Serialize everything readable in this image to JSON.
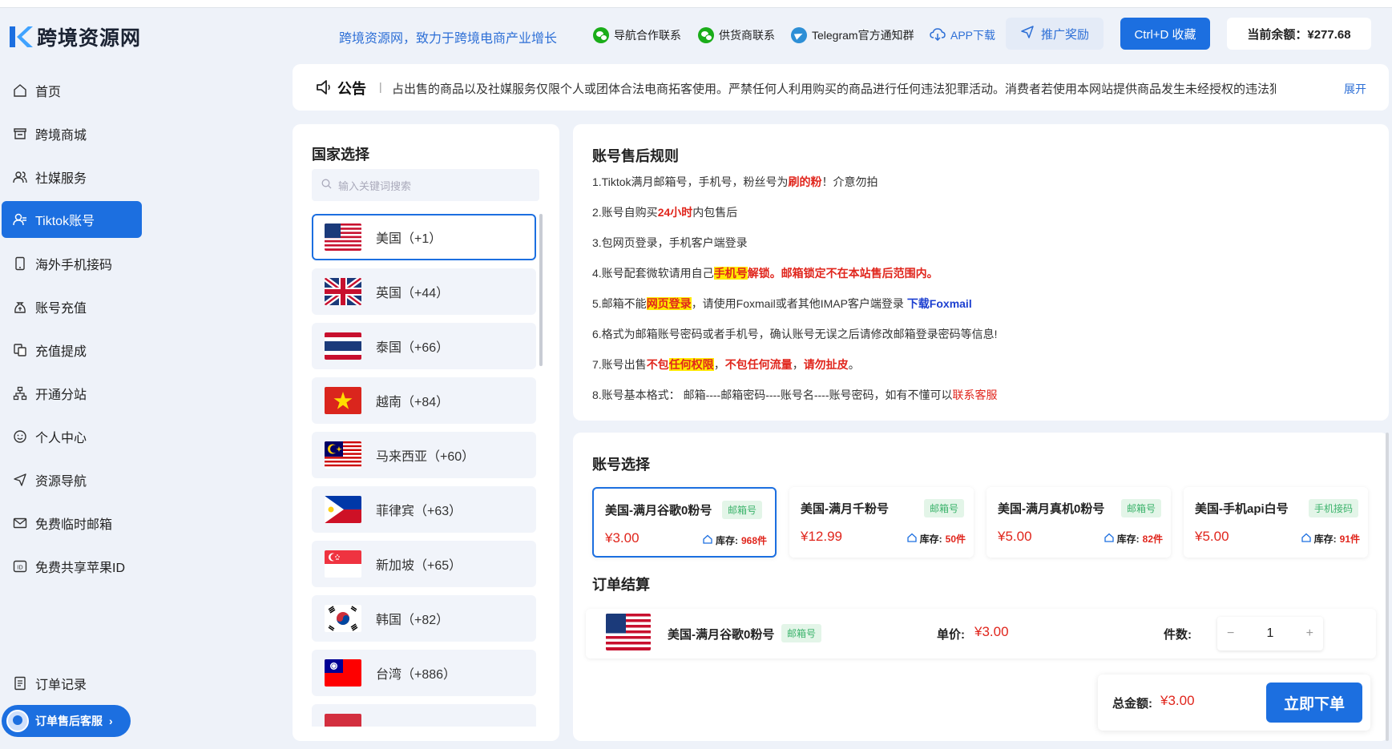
{
  "header": {
    "logo_text": "跨境资源网",
    "slogan": "跨境资源网，致力于跨境电商产业增长",
    "links": [
      {
        "label": "导航合作联系",
        "icon": "wechat-icon"
      },
      {
        "label": "供货商联系",
        "icon": "wechat-icon"
      },
      {
        "label": "Telegram官方通知群",
        "icon": "telegram-icon"
      },
      {
        "label": "APP下载",
        "icon": "cloud-download-icon"
      }
    ],
    "promo_label": "推广奖励",
    "favorite_label": "Ctrl+D 收藏",
    "balance_label": "当前余额：¥277.68"
  },
  "sidebar": {
    "items": [
      {
        "label": "首页",
        "icon": "home-icon"
      },
      {
        "label": "跨境商城",
        "icon": "store-icon"
      },
      {
        "label": "社媒服务",
        "icon": "users-icon"
      },
      {
        "label": "Tiktok账号",
        "icon": "user-icon",
        "active": true
      },
      {
        "label": "海外手机接码",
        "icon": "phone-icon"
      },
      {
        "label": "账号充值",
        "icon": "money-bag-icon"
      },
      {
        "label": "充值提成",
        "icon": "copy-icon"
      },
      {
        "label": "开通分站",
        "icon": "sitemap-icon"
      },
      {
        "label": "个人中心",
        "icon": "smile-icon"
      },
      {
        "label": "资源导航",
        "icon": "send-icon"
      },
      {
        "label": "免费临时邮箱",
        "icon": "mail-icon"
      },
      {
        "label": "免费共享苹果ID",
        "icon": "id-icon"
      }
    ],
    "order_records": "订单记录",
    "service_label": "订单售后客服"
  },
  "notice": {
    "title": "公告",
    "separator": "|",
    "text": "占出售的商品以及社媒服务仅限个人或团体合法电商拓客使用。严禁任何人利用购买的商品进行任何违法犯罪活动。消费者若使用本网站提供商品发生未经授权的违法犯",
    "expand": "展开"
  },
  "country": {
    "title": "国家选择",
    "search_placeholder": "输入关键词搜索",
    "items": [
      {
        "label": "美国（+1）",
        "flag": "us"
      },
      {
        "label": "英国（+44）",
        "flag": "uk"
      },
      {
        "label": "泰国（+66）",
        "flag": "th"
      },
      {
        "label": "越南（+84）",
        "flag": "vn"
      },
      {
        "label": "马来西亚（+60）",
        "flag": "my"
      },
      {
        "label": "菲律宾（+63）",
        "flag": "ph"
      },
      {
        "label": "新加坡（+65）",
        "flag": "sg"
      },
      {
        "label": "韩国（+82）",
        "flag": "kr"
      },
      {
        "label": "台湾（+886）",
        "flag": "tw"
      }
    ]
  },
  "rules": {
    "title": "账号售后规则",
    "r1_a": "1.Tiktok满月邮箱号，手机号，粉丝号为",
    "r1_b": "刷的粉",
    "r1_c": "！介意勿拍",
    "r2_a": "2.账号自购买",
    "r2_b": "24小时",
    "r2_c": "内包售后",
    "r3": "3.包网页登录，手机客户端登录",
    "r4_a": "4.账号配套微软请用自己",
    "r4_b": "手机号",
    "r4_c": "解锁",
    "r4_d": "。邮箱锁定不在本站售后范围内。",
    "r5_a": "5.邮箱不能",
    "r5_b": "网页登录",
    "r5_c": "，请使用Foxmail或者其他IMAP客户端登录 ",
    "r5_d": "下载Foxmail",
    "r6": "6.格式为邮箱账号密码或者手机号，确认账号无误之后请修改邮箱登录密码等信息!",
    "r7_a": "7.账号出售",
    "r7_b": "不包",
    "r7_c": "任何权限",
    "r7_d": "，",
    "r7_e": "不包任何流量",
    "r7_f": "，",
    "r7_g": "请勿扯皮",
    "r7_h": "。",
    "r8_a": "8.账号基本格式：  邮箱----邮箱密码----账号名----账号密码，如有不懂可以",
    "r8_b": "联系客服"
  },
  "accounts": {
    "title": "账号选择",
    "stock_label": "库存:",
    "cards": [
      {
        "name": "美国-满月谷歌0粉号",
        "tag": "邮箱号",
        "price": "¥3.00",
        "stock": "968件"
      },
      {
        "name": "美国-满月千粉号",
        "tag": "邮箱号",
        "price": "¥12.99",
        "stock": "50件"
      },
      {
        "name": "美国-满月真机0粉号",
        "tag": "邮箱号",
        "price": "¥5.00",
        "stock": "82件"
      },
      {
        "name": "美国-手机api白号",
        "tag": "手机接码",
        "price": "¥5.00",
        "stock": "91件"
      }
    ]
  },
  "order": {
    "title": "订单结算",
    "product_name": "美国-满月谷歌0粉号",
    "product_tag": "邮箱号",
    "unit_label": "单价:",
    "unit_price": "¥3.00",
    "qty_label": "件数:",
    "qty": "1",
    "minus": "−",
    "plus": "+",
    "total_label": "总金额:",
    "total_value": "¥3.00",
    "submit_label": "立即下单"
  }
}
